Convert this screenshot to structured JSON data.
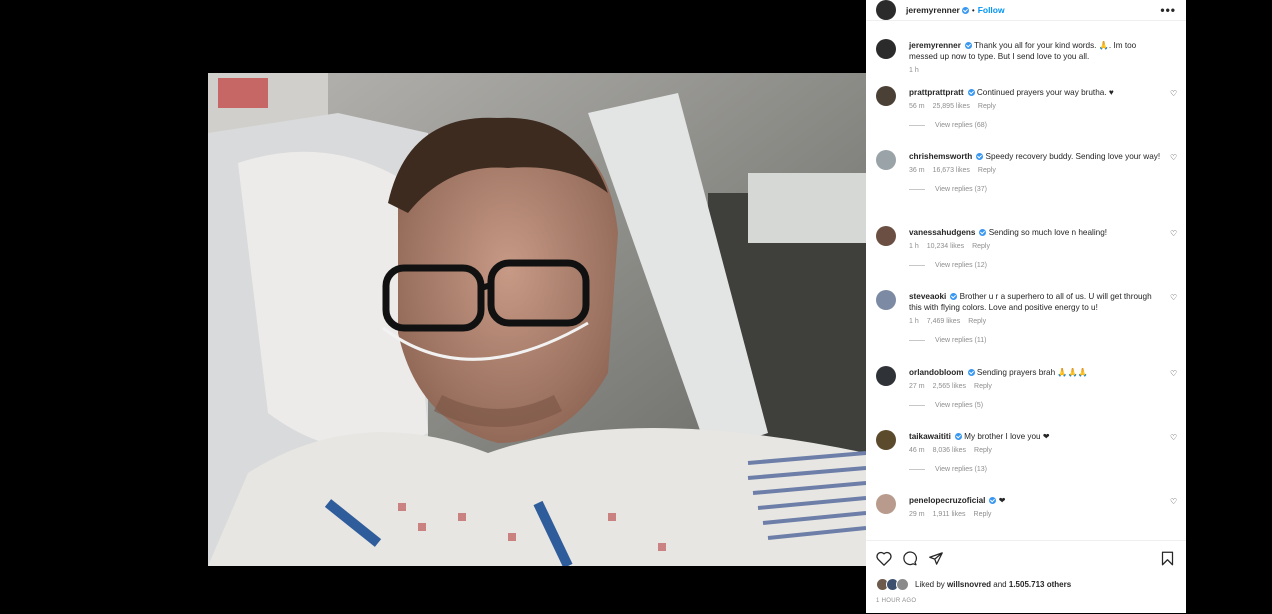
{
  "post": {
    "username": "jeremyrenner",
    "follow_label": "Follow",
    "more_label": "•••",
    "caption": "Thank you all for your kind words. 🙏. Im too messed up now to type. But I send love to you all.",
    "caption_time": "1 h"
  },
  "comments": [
    {
      "user": "prattprattpratt",
      "text": "Continued prayers your way brutha. ♥",
      "time": "56 m",
      "likes": "25,895 likes",
      "reply": "Reply",
      "replies": "View replies (68)",
      "avatar_color": "#4a4036"
    },
    {
      "user": "chrishemsworth",
      "text": "Speedy recovery buddy. Sending love your way!",
      "time": "36 m",
      "likes": "16,673 likes",
      "reply": "Reply",
      "replies": "View replies (37)",
      "avatar_color": "#9aa3a8"
    },
    {
      "user": "vanessahudgens",
      "text": "Sending so much love n healing!",
      "time": "1 h",
      "likes": "10,234 likes",
      "reply": "Reply",
      "replies": "View replies (12)",
      "avatar_color": "#6b4f43"
    },
    {
      "user": "steveaoki",
      "text": "Brother u r a superhero to all of us. U will get through this with flying colors. Love and positive energy to u!",
      "time": "1 h",
      "likes": "7,469 likes",
      "reply": "Reply",
      "replies": "View replies (11)",
      "avatar_color": "#7d8aa3"
    },
    {
      "user": "orlandobloom",
      "text": "Sending prayers brah 🙏🙏🙏",
      "time": "27 m",
      "likes": "2,565 likes",
      "reply": "Reply",
      "replies": "View replies (5)",
      "avatar_color": "#2f3338"
    },
    {
      "user": "taikawaititi",
      "text": "My brother I love you ❤",
      "time": "46 m",
      "likes": "8,036 likes",
      "reply": "Reply",
      "replies": "View replies (13)",
      "avatar_color": "#5c4a2c"
    },
    {
      "user": "penelopecruzoficial",
      "text": "❤",
      "time": "29 m",
      "likes": "1,911 likes",
      "reply": "Reply",
      "replies": "",
      "avatar_color": "#b89b8c"
    }
  ],
  "likes": {
    "prefix": "Liked by",
    "user": "willsnovred",
    "and": "and",
    "count": "1.505.713 others"
  },
  "timestamp": "1 HOUR AGO",
  "colors": {
    "accent": "#0095f6",
    "verified": "#3897f0",
    "heart": "#ed4956"
  }
}
